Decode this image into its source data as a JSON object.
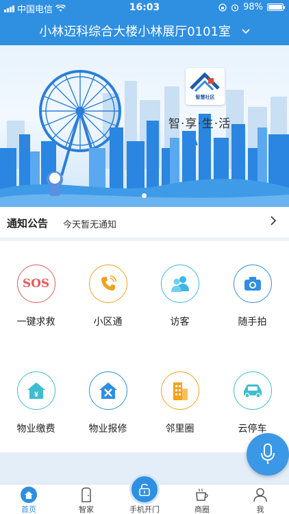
{
  "status_bar": {
    "carrier": "中国电信",
    "time": "16:03",
    "battery": "98%",
    "battery_level": 0.98
  },
  "header": {
    "title": "小林迈科综合大楼小林展厅0101室",
    "dropdown_icon": "chevron-down-icon"
  },
  "banner": {
    "logo_text": "智慧社区",
    "slogan": "智·享·生·活"
  },
  "notice": {
    "label": "通知公告",
    "text": "今天暂无通知",
    "arrow_icon": "chevron-right-icon"
  },
  "services": [
    {
      "label": "一键求救",
      "icon": "sos-icon",
      "color": "#e25a5a"
    },
    {
      "label": "小区通",
      "icon": "phone-call-icon",
      "color": "#f2a21b"
    },
    {
      "label": "访客",
      "icon": "visitors-icon",
      "color": "#3db6e6"
    },
    {
      "label": "随手拍",
      "icon": "camera-icon",
      "color": "#2f8fe0"
    },
    {
      "label": "物业缴费",
      "icon": "house-yen-icon",
      "color": "#3dbdd0"
    },
    {
      "label": "物业报修",
      "icon": "house-tools-icon",
      "color": "#2f8fe0"
    },
    {
      "label": "邻里圈",
      "icon": "buildings-icon",
      "color": "#f2a21b"
    },
    {
      "label": "云停车",
      "icon": "car-icon",
      "color": "#3dbdd0"
    }
  ],
  "tabbar": {
    "items": [
      {
        "label": "首页",
        "icon": "home-icon"
      },
      {
        "label": "智家",
        "icon": "door-icon"
      },
      {
        "label": "手机开门",
        "icon": "unlock-icon"
      },
      {
        "label": "商圈",
        "icon": "coffee-cup-icon"
      },
      {
        "label": "我",
        "icon": "user-icon"
      }
    ],
    "active": "首页"
  },
  "voice_button": {
    "icon": "microphone-icon"
  },
  "colors": {
    "primary": "#2f8fe0",
    "background": "#eef3f8"
  }
}
